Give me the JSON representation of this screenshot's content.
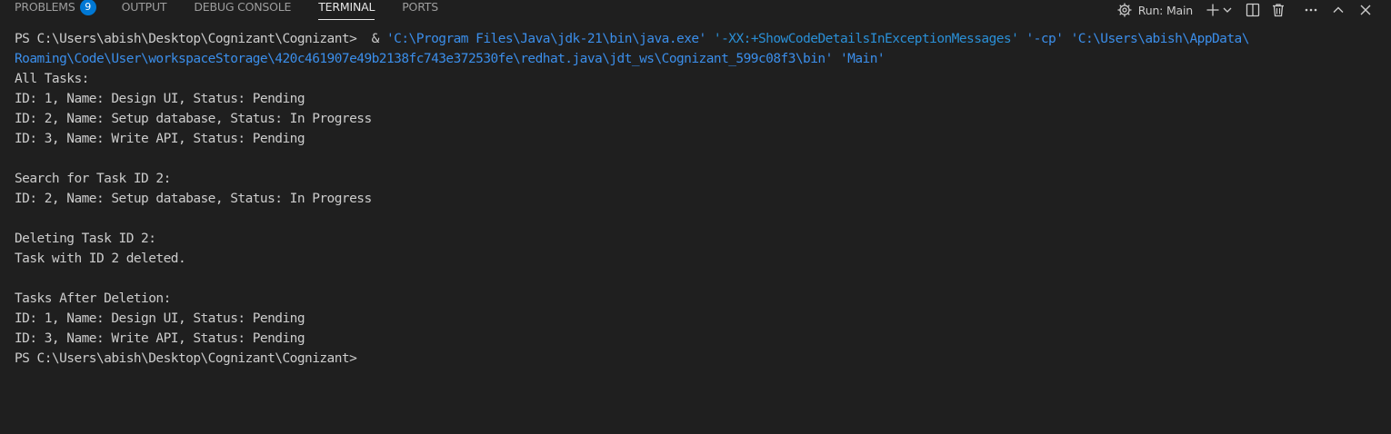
{
  "panel": {
    "tabs": [
      {
        "label": "PROBLEMS",
        "badge": "9"
      },
      {
        "label": "OUTPUT"
      },
      {
        "label": "DEBUG CONSOLE"
      },
      {
        "label": "TERMINAL"
      },
      {
        "label": "PORTS"
      }
    ],
    "active_tab": "TERMINAL",
    "run_label": "Run: Main"
  },
  "terminal": {
    "prompt_1": "PS C:\\Users\\abish\\Desktop\\Cognizant\\Cognizant> ",
    "cmd_amp": " & ",
    "cmd_java": "'C:\\Program Files\\Java\\jdk-21\\bin\\java.exe'",
    "cmd_flag": "'-XX:+ShowCodeDetailsInExceptionMessages'",
    "cmd_cp": "'-cp'",
    "cmd_path_1": "'C:\\Users\\abish\\AppData\\",
    "cmd_path_2": "Roaming\\Code\\User\\workspaceStorage\\420c461907e49b2138fc743e372530fe\\redhat.java\\jdt_ws\\Cognizant_599c08f3\\bin'",
    "cmd_main": "'Main'",
    "output": [
      "All Tasks:",
      "ID: 1, Name: Design UI, Status: Pending",
      "ID: 2, Name: Setup database, Status: In Progress",
      "ID: 3, Name: Write API, Status: Pending",
      "",
      "Search for Task ID 2:",
      "ID: 2, Name: Setup database, Status: In Progress",
      "",
      "Deleting Task ID 2:",
      "Task with ID 2 deleted.",
      "",
      "Tasks After Deletion:",
      "ID: 1, Name: Design UI, Status: Pending",
      "ID: 3, Name: Write API, Status: Pending"
    ],
    "prompt_2": "PS C:\\Users\\abish\\Desktop\\Cognizant\\Cognizant>"
  },
  "colors": {
    "background": "#1f1f1f",
    "string": "#3b8eea",
    "text": "#cccccc",
    "badge": "#0078d4"
  }
}
